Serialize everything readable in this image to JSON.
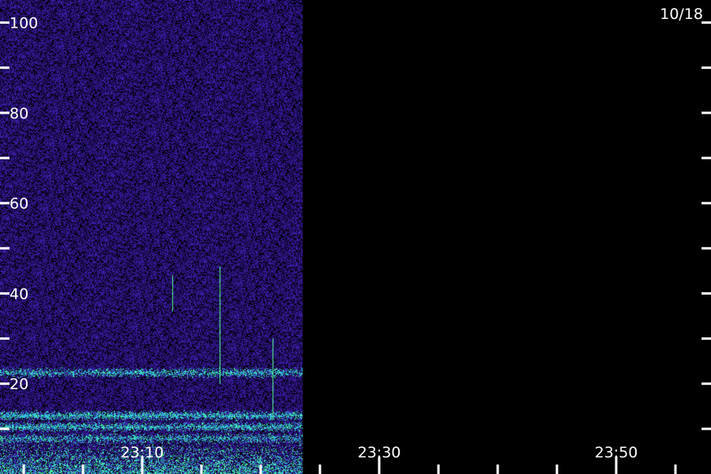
{
  "chart_data": {
    "type": "heatmap",
    "date_label": "10/18",
    "x_ticks": [
      {
        "label": "23:10",
        "minute": 10
      },
      {
        "label": "23:30",
        "minute": 30
      },
      {
        "label": "23:50",
        "minute": 50
      }
    ],
    "y_ticks": [
      {
        "label": "20",
        "value": 20
      },
      {
        "label": "40",
        "value": 40
      },
      {
        "label": "60",
        "value": 60
      },
      {
        "label": "80",
        "value": 80
      },
      {
        "label": "100",
        "value": 100
      }
    ],
    "x_range_minutes": [
      -2,
      58
    ],
    "y_range": [
      0,
      105
    ],
    "data_end_minute": 23.5,
    "bands": [
      {
        "value": 22.5,
        "intensity": 0.6
      },
      {
        "value": 13,
        "intensity": 0.75
      },
      {
        "value": 10.5,
        "intensity": 0.7
      },
      {
        "value": 8,
        "intensity": 0.55
      }
    ],
    "spikes": [
      {
        "minute": 12.5,
        "from": 36,
        "to": 44
      },
      {
        "minute": 16.5,
        "from": 20,
        "to": 46
      },
      {
        "minute": 21,
        "from": 12,
        "to": 30
      }
    ],
    "colors": {
      "background": "#000000",
      "noise": "#3a1ca0",
      "noise_dark": "#1a0a5a",
      "band": "#30c0e0",
      "band_hot": "#50ff90",
      "axis": "#ffffff"
    }
  }
}
